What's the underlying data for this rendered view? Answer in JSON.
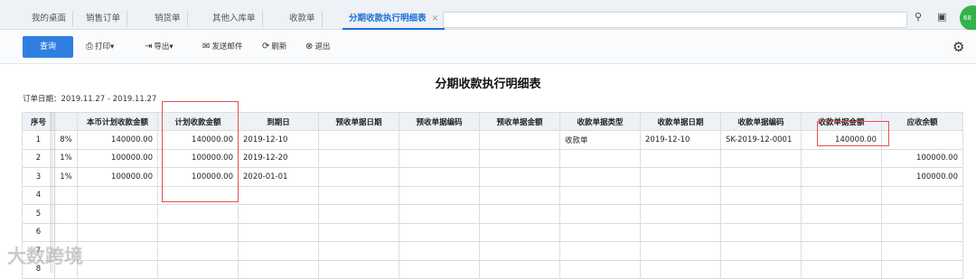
{
  "tabs": [
    {
      "label": "我的桌面",
      "active": false
    },
    {
      "label": "销售订单",
      "active": false
    },
    {
      "label": "销货单",
      "active": false
    },
    {
      "label": "其他入库单",
      "active": false
    },
    {
      "label": "收款单",
      "active": false
    },
    {
      "label": "分期收款执行明细表",
      "active": true
    }
  ],
  "tab_close_glyph": "×",
  "window_icons": [
    "search-icon",
    "fullscreen-icon",
    "close-icon"
  ],
  "badge_text": "68",
  "toolbar": {
    "query_label": "查询",
    "print_label": "打印",
    "export_label": "导出",
    "send_mail_label": "发送邮件",
    "refresh_label": "刷新",
    "exit_label": "退出"
  },
  "report": {
    "title": "分期收款执行明细表",
    "date_range": "订单日期：2019.11.27 - 2019.11.27"
  },
  "table": {
    "headers": [
      "序号",
      "",
      "本币计划收款金额",
      "计划收款金额",
      "到期日",
      "预收单据日期",
      "预收单据编码",
      "预收单据金额",
      "收款单据类型",
      "收款单据日期",
      "收款单据编码",
      "收款单据金额",
      "应收余额"
    ],
    "rows": [
      [
        "1",
        "8%",
        "140000.00",
        "140000.00",
        "2019-12-10",
        "",
        "",
        "",
        "收款单",
        "2019-12-10",
        "SK-2019-12-0001",
        "140000.00",
        ""
      ],
      [
        "2",
        "1%",
        "100000.00",
        "100000.00",
        "2019-12-20",
        "",
        "",
        "",
        "",
        "",
        "",
        "",
        "100000.00"
      ],
      [
        "3",
        "1%",
        "100000.00",
        "100000.00",
        "2020-01-01",
        "",
        "",
        "",
        "",
        "",
        "",
        "",
        "100000.00"
      ],
      [
        "4",
        "",
        "",
        "",
        "",
        "",
        "",
        "",
        "",
        "",
        "",
        "",
        ""
      ],
      [
        "5",
        "",
        "",
        "",
        "",
        "",
        "",
        "",
        "",
        "",
        "",
        "",
        ""
      ],
      [
        "6",
        "",
        "",
        "",
        "",
        "",
        "",
        "",
        "",
        "",
        "",
        "",
        ""
      ],
      [
        "7",
        "",
        "",
        "",
        "",
        "",
        "",
        "",
        "",
        "",
        "",
        "",
        ""
      ],
      [
        "8",
        "",
        "",
        "",
        "",
        "",
        "",
        "",
        "",
        "",
        "",
        "",
        ""
      ]
    ]
  },
  "watermark": "大数跨境",
  "accent_color": "#2f7fe0",
  "highlight_color": "#e4514f"
}
